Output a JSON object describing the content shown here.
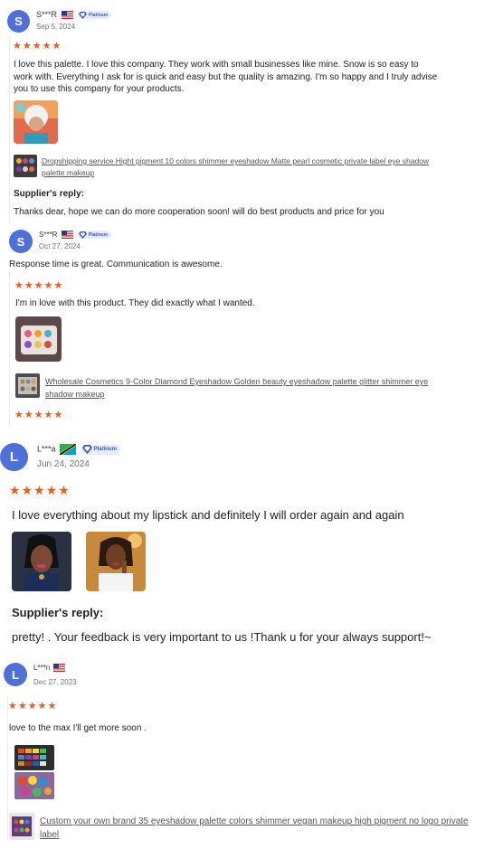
{
  "reviews": [
    {
      "avatar": "S",
      "name": "S***R",
      "date": "Sep 5, 2024",
      "badge": "Platinum",
      "stars": "★★★★★",
      "text": "I love this palette. I love this company. They work with small businesses like mine. Snow is so easy to work with. Everything I ask for is quick and easy but the quality is amazing. I'm so happy and I truly advise you to use this company for your products.",
      "product": "Dropshipping service Hight pigment 10 colors shimmer eyeshadow Matte pearl cosmetic private label eye shadow palette makeup",
      "reply_label": "Supplier's reply:",
      "reply": "Thanks dear, hope we can do more cooperation soon! will do best products and price for you"
    },
    {
      "avatar": "S",
      "name": "S***R",
      "date": "Oct 27, 2024",
      "badge": "Platinum",
      "summary": "Response time is great. Communication is awesome.",
      "stars": "★★★★★",
      "text": "I'm in love with this product. They did exactly what I wanted.",
      "product": "Wholesale Cosmetics 9-Color Diamond Eyeshadow Golden beauty eyeshadow palette glitter shimmer eye shadow makeup",
      "stars_after": "★★★★★"
    },
    {
      "avatar": "L",
      "name": "L***a",
      "date": "Jun 24, 2024",
      "badge": "Platinum",
      "stars": "★★★★★",
      "text": "I love everything about my lipstick and definitely I will order again and again",
      "reply_label": "Supplier's reply:",
      "reply": "pretty! . Your feedback is very important to us !Thank u for your always support!~"
    },
    {
      "avatar": "L",
      "name": "L***n",
      "date": "Dec 27, 2023",
      "stars": "★★★★★",
      "text": "love to the max I'll get more soon .",
      "product": "Custom your own brand 35 eyeshadow palette colors shimmer vegan makeup high pigment no logo private label"
    }
  ],
  "icons": [
    "us-flag-icon",
    "tanzania-flag-icon",
    "platinum-diamond-icon"
  ],
  "colors": {
    "accent": "#f25a1d",
    "avatar": "#4f6fd9",
    "badge_text": "#3a57c8"
  }
}
